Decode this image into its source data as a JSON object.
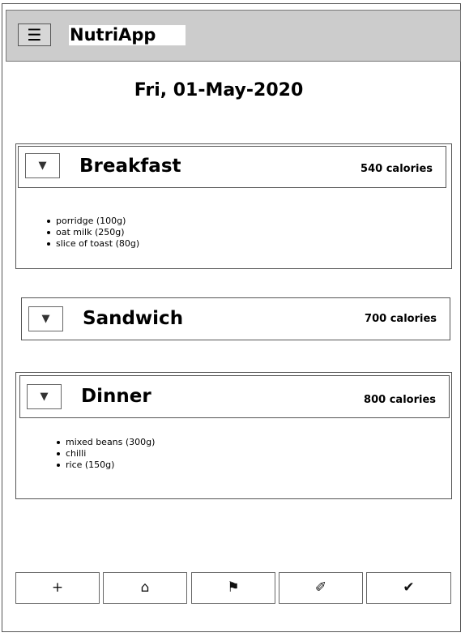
{
  "header": {
    "menu_icon": "☰",
    "title": "NutriApp"
  },
  "date": "Fri, 01-May-2020",
  "meals": [
    {
      "name": "Breakfast",
      "calories": "540 calories",
      "toggle_icon": "▼",
      "items": [
        "porridge (100g)",
        "oat milk (250g)",
        "slice of toast (80g)"
      ]
    },
    {
      "name": "Sandwich",
      "calories": "700 calories",
      "toggle_icon": "▼",
      "items": []
    },
    {
      "name": "Dinner",
      "calories": "800 calories",
      "toggle_icon": "▼",
      "items": [
        "mixed beans (300g)",
        "chilli",
        "rice (150g)"
      ]
    }
  ],
  "bottom_nav": [
    {
      "icon": "plus-icon",
      "glyph": "+"
    },
    {
      "icon": "home-icon",
      "glyph": "⌂"
    },
    {
      "icon": "flag-icon",
      "glyph": "⚑"
    },
    {
      "icon": "pencil-icon",
      "glyph": "✐"
    },
    {
      "icon": "check-icon",
      "glyph": "✔"
    }
  ],
  "colors": {
    "header_background": "#cccccc",
    "border": "#555555"
  }
}
